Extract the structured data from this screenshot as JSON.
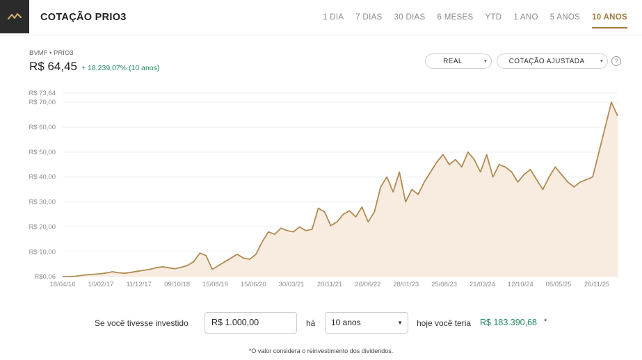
{
  "header": {
    "title": "COTAÇÃO PRIO3",
    "tabs": [
      {
        "label": "1 DIA",
        "active": false
      },
      {
        "label": "7 DIAS",
        "active": false
      },
      {
        "label": "30 DIAS",
        "active": false
      },
      {
        "label": "6 MESES",
        "active": false
      },
      {
        "label": "YTD",
        "active": false
      },
      {
        "label": "1 ANO",
        "active": false
      },
      {
        "label": "5 ANOS",
        "active": false
      },
      {
        "label": "10 ANOS",
        "active": true
      }
    ],
    "logo_icon": "pulse-icon"
  },
  "info": {
    "ticker": "BVMF • PRIO3",
    "price": "R$ 64,45",
    "change": "+ 18.239,07% (10 anos)",
    "currency_select": "REAL",
    "quote_select": "COTAÇÃO AJUSTADA",
    "help_icon": "?"
  },
  "colors": {
    "accent": "#a07a3c",
    "line": "#b08a52",
    "area": "#f8ece0",
    "positive": "#1f8a5b"
  },
  "chart_data": {
    "type": "area",
    "ymin_label": "R$0,06",
    "ymax_label": "R$ 73,64",
    "ylim": [
      0.06,
      73.64
    ],
    "y_ticks": [
      {
        "value": 10,
        "label": "R$ 10,00"
      },
      {
        "value": 20,
        "label": "R$ 20,00"
      },
      {
        "value": 30,
        "label": "R$ 30,00"
      },
      {
        "value": 40,
        "label": "R$ 40,00"
      },
      {
        "value": 50,
        "label": "R$ 50,00"
      },
      {
        "value": 60,
        "label": "R$ 60,00"
      },
      {
        "value": 70,
        "label": "R$ 70,00"
      }
    ],
    "x_ticks": [
      "18/04/16",
      "10/02/17",
      "11/12/17",
      "09/10/18",
      "15/08/19",
      "15/06/20",
      "30/03/21",
      "20/11/21",
      "26/06/22",
      "28/01/23",
      "25/08/23",
      "21/03/24",
      "12/10/24",
      "05/05/25",
      "26/11/25"
    ],
    "series": [
      {
        "values": [
          0.06,
          0.1,
          0.2,
          0.5,
          0.8,
          1.0,
          1.2,
          1.5,
          2.0,
          1.6,
          1.4,
          1.8,
          2.2,
          2.6,
          3.0,
          3.6,
          4.0,
          3.6,
          3.2,
          3.8,
          4.5,
          6.0,
          9.5,
          8.5,
          3.0,
          4.5,
          6.0,
          7.5,
          9.0,
          7.5,
          7.0,
          9.0,
          14.0,
          18.0,
          17.0,
          19.5,
          18.5,
          18.0,
          20.0,
          18.5,
          19.0,
          27.5,
          26.0,
          20.5,
          22.0,
          25.0,
          26.5,
          24.0,
          28.0,
          22.0,
          26.0,
          36.0,
          40.0,
          34.0,
          42.0,
          30.0,
          35.0,
          33.0,
          38.0,
          42.0,
          46.0,
          49.0,
          45.0,
          47.0,
          44.0,
          50.0,
          47.0,
          42.0,
          49.0,
          40.0,
          45.0,
          44.0,
          42.0,
          38.0,
          41.0,
          43.0,
          39.0,
          35.0,
          40.0,
          44.0,
          41.0,
          38.0,
          36.0,
          38.0,
          39.0,
          40.0,
          50.0,
          60.0,
          70.0,
          64.45
        ]
      }
    ]
  },
  "calculator": {
    "prefix": "Se você tivesse investido",
    "amount": "R$ 1.000,00",
    "middle": "há",
    "period": "10 anos",
    "suffix": "hoje você teria",
    "result": "R$ 183.390,68",
    "asterisk": "*",
    "footnote": "*O valor considera o reinvestimento dos dividendos."
  }
}
